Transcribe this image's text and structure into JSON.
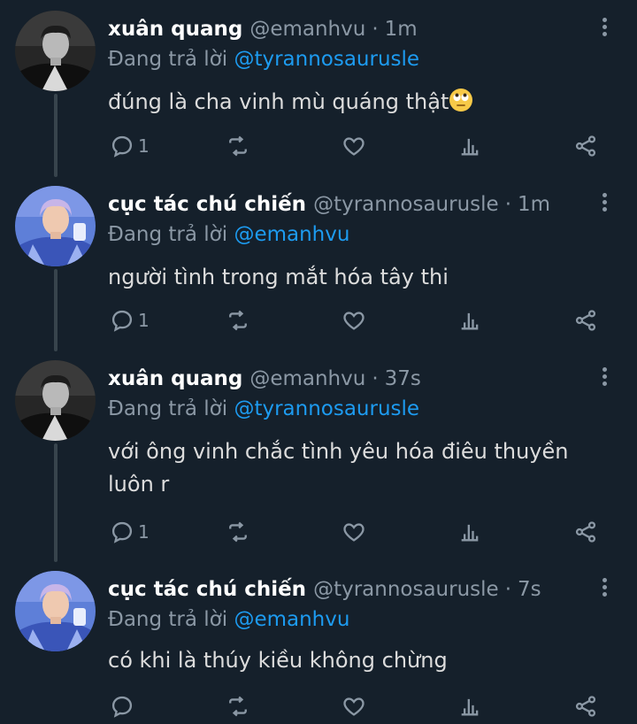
{
  "tweets": [
    {
      "name": "xuân quang",
      "handle": "@emanhvu",
      "separator": "·",
      "time": "1m",
      "reply_prefix": "Đang trả lời",
      "reply_to": "@tyrannosaurusle",
      "text": "đúng là cha vinh mù quáng thật",
      "emoji": "face-with-rolling-eyes",
      "reply_count": "1",
      "avatar": "avatar-xuan-quang"
    },
    {
      "name": "cục tác chú chiến",
      "handle": "@tyrannosaurusle",
      "separator": "·",
      "time": "1m",
      "reply_prefix": "Đang trả lời",
      "reply_to": "@emanhvu",
      "text": "người tình trong mắt hóa tây thi",
      "reply_count": "1",
      "avatar": "avatar-cuc-tac-chu-chien"
    },
    {
      "name": "xuân quang",
      "handle": "@emanhvu",
      "separator": "·",
      "time": "37s",
      "reply_prefix": "Đang trả lời",
      "reply_to": "@tyrannosaurusle",
      "text": "với ông vinh chắc tình yêu hóa điêu thuyền luôn r",
      "reply_count": "1",
      "avatar": "avatar-xuan-quang"
    },
    {
      "name": "cục tác chú chiến",
      "handle": "@tyrannosaurusle",
      "separator": "·",
      "time": "7s",
      "reply_prefix": "Đang trả lời",
      "reply_to": "@emanhvu",
      "text": "có khi là thúy kiều không chừng",
      "reply_count": "",
      "avatar": "avatar-cuc-tac-chu-chien"
    }
  ],
  "colors": {
    "background": "#15202b",
    "mention": "#1d9bf0",
    "muted": "#8b98a5",
    "thread_line": "#38444d"
  },
  "icons": [
    "reply-icon",
    "retweet-icon",
    "like-icon",
    "stats-icon",
    "share-icon",
    "more-icon"
  ]
}
